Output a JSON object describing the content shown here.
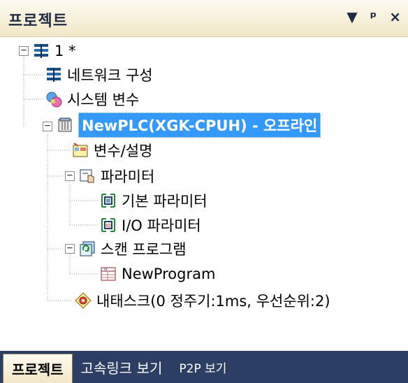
{
  "panel": {
    "title": "프로젝트",
    "buttons": {
      "dropdown": "▼",
      "pin": "ᵖ",
      "close": "×"
    }
  },
  "tree": {
    "root": "1 *",
    "network": "네트워크 구성",
    "sysvar": "시스템 변수",
    "plc": "NewPLC(XGK-CPUH) - 오프라인",
    "vars": "변수/설명",
    "params": "파라미터",
    "basic_params": "기본 파라미터",
    "io_params": "I/O 파라미터",
    "scan_program": "스캔 프로그램",
    "new_program": "NewProgram",
    "task": "내태스크(0 정주기:1ms, 우선순위:2)"
  },
  "tabs": [
    "프로젝트",
    "고속링크 보기",
    "P2P 보기"
  ],
  "colors": {
    "header_bg": "#f2e7c6",
    "selection": "#3399ff",
    "tab_strip": "#2c3e63"
  }
}
